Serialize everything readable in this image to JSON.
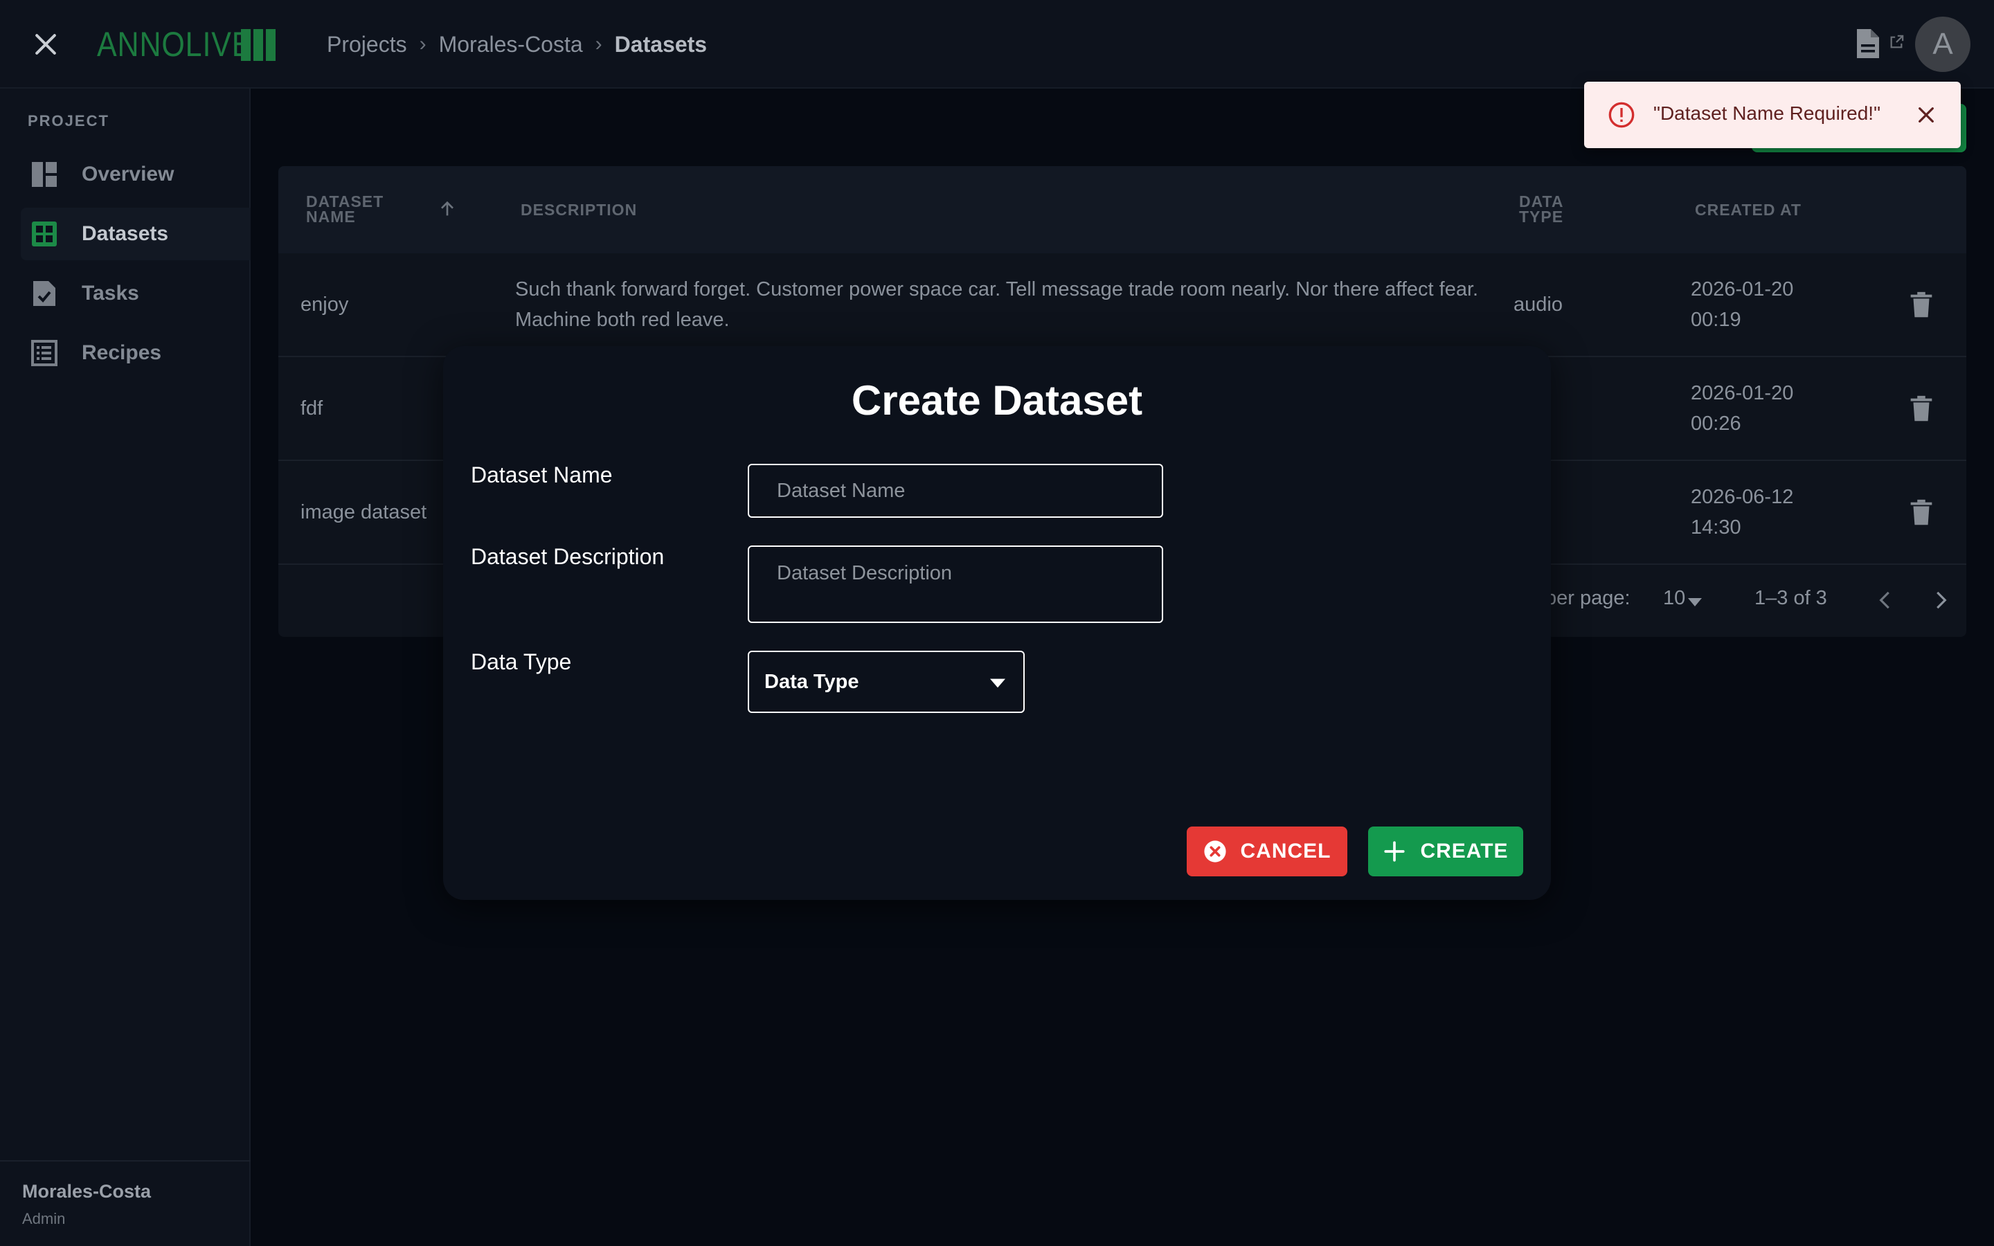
{
  "header": {
    "logo_text": "ANNOLIVE",
    "breadcrumb": [
      "Projects",
      "Morales-Costa",
      "Datasets"
    ],
    "breadcrumb_separator": "›",
    "avatar_initial": "A"
  },
  "sidebar": {
    "heading": "PROJECT",
    "items": [
      {
        "label": "Overview",
        "icon": "dashboard-icon",
        "active": false
      },
      {
        "label": "Datasets",
        "icon": "grid-icon",
        "active": true
      },
      {
        "label": "Tasks",
        "icon": "task-file-icon",
        "active": false
      },
      {
        "label": "Recipes",
        "icon": "list-icon",
        "active": false
      }
    ],
    "footer": {
      "name": "Morales-Costa",
      "role": "Admin"
    }
  },
  "table": {
    "columns": [
      "Dataset Name",
      "Description",
      "Data Type",
      "Created At"
    ],
    "rows": [
      {
        "name": "enjoy",
        "description": "Such thank forward forget. Customer power space car. Tell message trade room nearly. Nor there affect fear. Machine both red leave.",
        "type": "audio",
        "created": "2026-01-20 00:19"
      },
      {
        "name": "fdf",
        "description": "",
        "type": "",
        "created": "2026-01-20 00:26"
      },
      {
        "name": "image dataset",
        "description": "",
        "type": "ge",
        "created": "2026-06-12 14:30"
      }
    ],
    "footer": {
      "rows_per_page_label": "per page:",
      "rows_per_page": "10",
      "range": "1–3 of 3"
    }
  },
  "dialog": {
    "title": "Create Dataset",
    "fields": {
      "name_label": "Dataset Name",
      "name_placeholder": "Dataset Name",
      "description_label": "Dataset Description",
      "description_placeholder": "Dataset Description",
      "type_label": "Data Type",
      "type_value": "Data Type"
    },
    "cancel_label": "CANCEL",
    "create_label": "CREATE"
  },
  "toast": {
    "message": "\"Dataset Name Required!\""
  },
  "colors": {
    "accent_green": "#149a4e",
    "danger_red": "#e53935",
    "toast_bg": "#fdeded",
    "background": "#060a12"
  }
}
